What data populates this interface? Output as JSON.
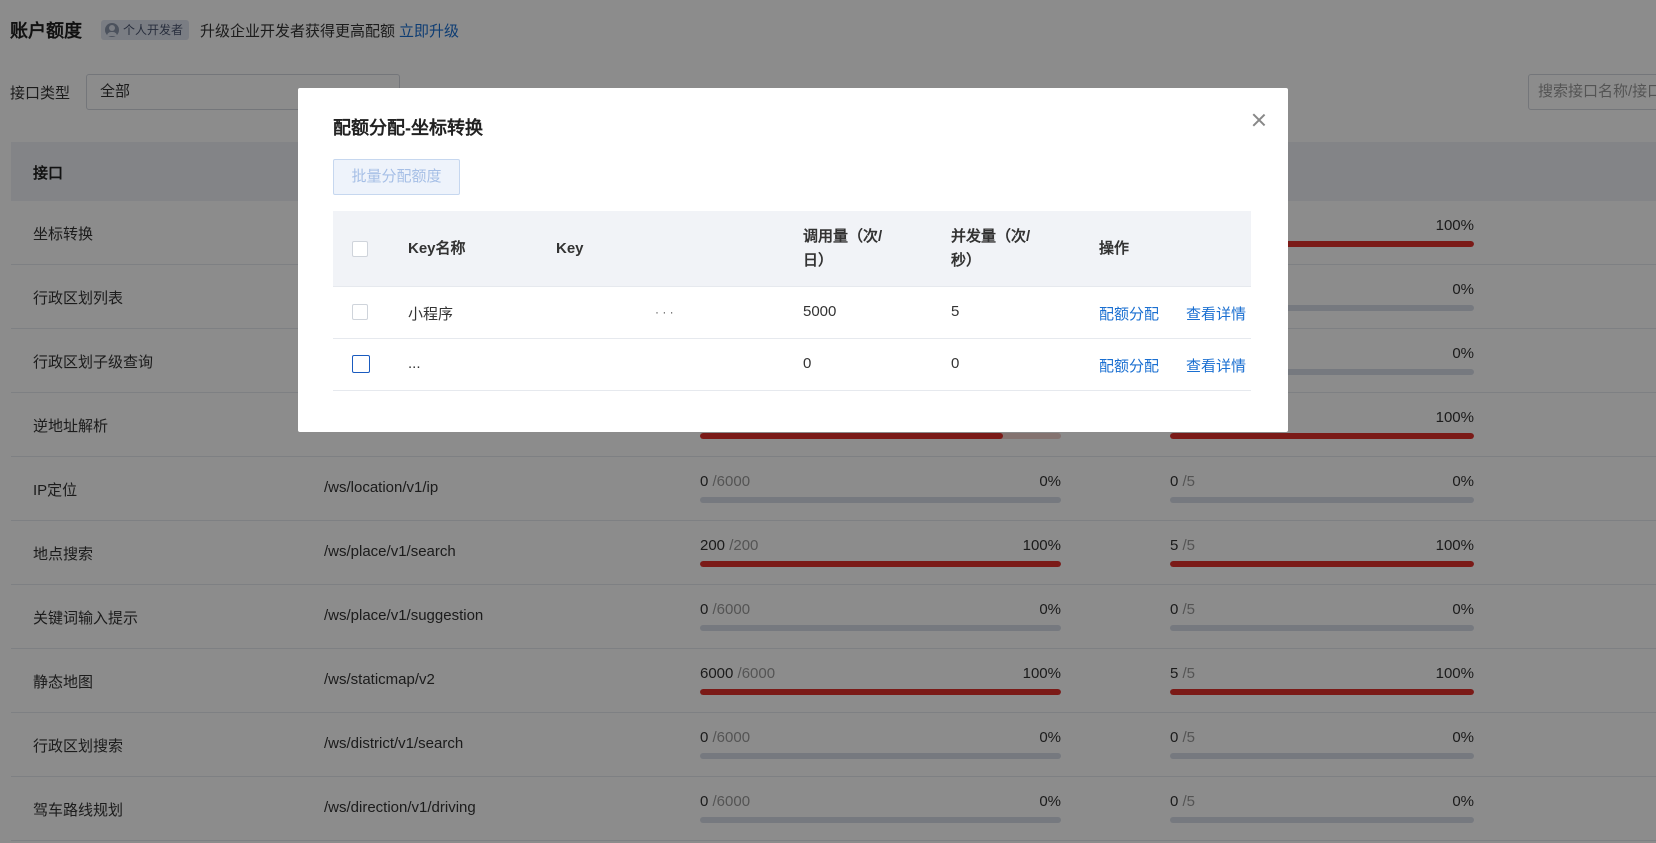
{
  "header": {
    "title": "账户额度",
    "badge": "个人开发者",
    "upgrade_text": "升级企业开发者获得更高配额",
    "upgrade_link": "立即升级"
  },
  "filter": {
    "label": "接口类型",
    "selected": "全部",
    "search_placeholder": "搜索接口名称/接口"
  },
  "main_table": {
    "header": "接口",
    "rows": [
      {
        "name": "坐标转换",
        "path": "",
        "calls": "",
        "calls_total": "",
        "calls_pct": "",
        "calls_fill": 1.0,
        "conc": "",
        "conc_total": "",
        "conc_pct": "100%",
        "conc_fill": 1.0
      },
      {
        "name": "行政区划列表",
        "path": "",
        "calls": "",
        "calls_total": "",
        "calls_pct": "",
        "calls_fill": 0,
        "conc": "",
        "conc_total": "",
        "conc_pct": "0%",
        "conc_fill": 0
      },
      {
        "name": "行政区划子级查询",
        "path": "",
        "calls": "",
        "calls_total": "",
        "calls_pct": "",
        "calls_fill": 0,
        "conc": "",
        "conc_total": "",
        "conc_pct": "0%",
        "conc_fill": 0
      },
      {
        "name": "逆地址解析",
        "path": "",
        "calls": "",
        "calls_total": "",
        "calls_pct": "",
        "calls_fill": 0.84,
        "conc": "",
        "conc_total": "",
        "conc_pct": "100%",
        "conc_fill": 1.0
      },
      {
        "name": "IP定位",
        "path": "/ws/location/v1/ip",
        "calls": "0",
        "calls_total": "/6000",
        "calls_pct": "0%",
        "calls_fill": 0,
        "conc": "0",
        "conc_total": "/5",
        "conc_pct": "0%",
        "conc_fill": 0
      },
      {
        "name": "地点搜索",
        "path": "/ws/place/v1/search",
        "calls": "200",
        "calls_total": "/200",
        "calls_pct": "100%",
        "calls_fill": 1.0,
        "conc": "5",
        "conc_total": "/5",
        "conc_pct": "100%",
        "conc_fill": 1.0
      },
      {
        "name": "关键词输入提示",
        "path": "/ws/place/v1/suggestion",
        "calls": "0",
        "calls_total": "/6000",
        "calls_pct": "0%",
        "calls_fill": 0,
        "conc": "0",
        "conc_total": "/5",
        "conc_pct": "0%",
        "conc_fill": 0
      },
      {
        "name": "静态地图",
        "path": "/ws/staticmap/v2",
        "calls": "6000",
        "calls_total": "/6000",
        "calls_pct": "100%",
        "calls_fill": 1.0,
        "conc": "5",
        "conc_total": "/5",
        "conc_pct": "100%",
        "conc_fill": 1.0
      },
      {
        "name": "行政区划搜索",
        "path": "/ws/district/v1/search",
        "calls": "0",
        "calls_total": "/6000",
        "calls_pct": "0%",
        "calls_fill": 0,
        "conc": "0",
        "conc_total": "/5",
        "conc_pct": "0%",
        "conc_fill": 0
      },
      {
        "name": "驾车路线规划",
        "path": "/ws/direction/v1/driving",
        "calls": "0",
        "calls_total": "/6000",
        "calls_pct": "0%",
        "calls_fill": 0,
        "conc": "0",
        "conc_total": "/5",
        "conc_pct": "0%",
        "conc_fill": 0
      }
    ]
  },
  "modal": {
    "title": "配额分配-坐标转换",
    "batch_button": "批量分配额度",
    "columns": {
      "name": "Key名称",
      "key": "Key",
      "calls": "调用量（次/日）",
      "concurrency": "并发量（次/秒）",
      "actions": "操作"
    },
    "rows": [
      {
        "name": "小程序",
        "key": "· · ·",
        "calls": "5000",
        "concurrency": "5",
        "action_allocate": "配额分配",
        "action_detail": "查看详情"
      },
      {
        "name": "...",
        "key": "",
        "calls": "0",
        "concurrency": "0",
        "action_allocate": "配额分配",
        "action_detail": "查看详情"
      }
    ]
  },
  "colors": {
    "accent": "#1a6fd1",
    "bar_full": "#e0302a",
    "bar_empty": "#d7dde8"
  }
}
